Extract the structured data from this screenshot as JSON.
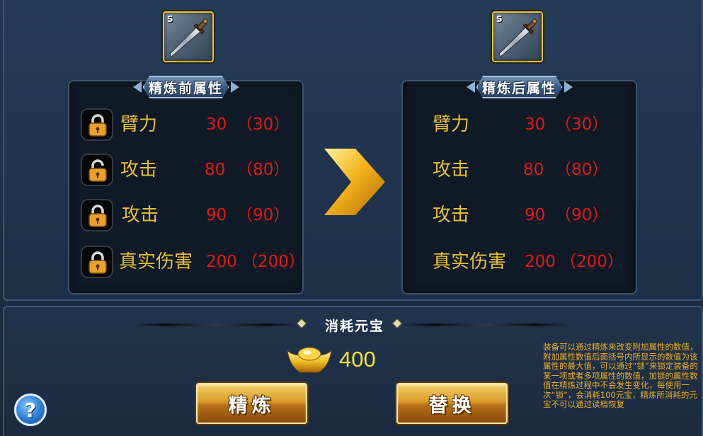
{
  "item": {
    "grade": "S"
  },
  "before": {
    "title": "精炼前属性",
    "rows": [
      {
        "name": "臂力",
        "value": "30",
        "max": "（30）"
      },
      {
        "name": "攻击",
        "value": "80",
        "max": "（80）"
      },
      {
        "name": "攻击",
        "value": "90",
        "max": "（90）"
      },
      {
        "name": "真实伤害",
        "value": "200",
        "max": "（200）"
      }
    ]
  },
  "after": {
    "title": "精炼后属性",
    "rows": [
      {
        "name": "臂力",
        "value": "30",
        "max": "（30）"
      },
      {
        "name": "攻击",
        "value": "80",
        "max": "（80）"
      },
      {
        "name": "攻击",
        "value": "90",
        "max": "（90）"
      },
      {
        "name": "真实伤害",
        "value": "200",
        "max": "（200）"
      }
    ]
  },
  "cost": {
    "title": "消耗元宝",
    "amount": "400"
  },
  "buttons": {
    "refine": "精炼",
    "replace": "替换",
    "help": "?"
  },
  "help_text": "装备可以通过精炼来改变附加属性的数值，附加属性数值后面括号内所显示的数值为该属性的最大值，可以通过“锁”来锁定装备的某一项或者多项属性的数值，加锁的属性数值在精炼过程中不会发生变化，每使用一次“锁”，会消耗100元宝，精炼所消耗的元宝不可以通过读档恢复",
  "colors": {
    "attr_name": "#e7be3a",
    "attr_value": "#e21818",
    "cost_amount": "#f3e33a",
    "help_text": "#f0b020"
  },
  "icons": {
    "item": "sword-icon",
    "lock": "padlock-icon",
    "arrow": "right-arrow-icon",
    "currency": "gold-ingot-icon",
    "help": "question-icon"
  }
}
